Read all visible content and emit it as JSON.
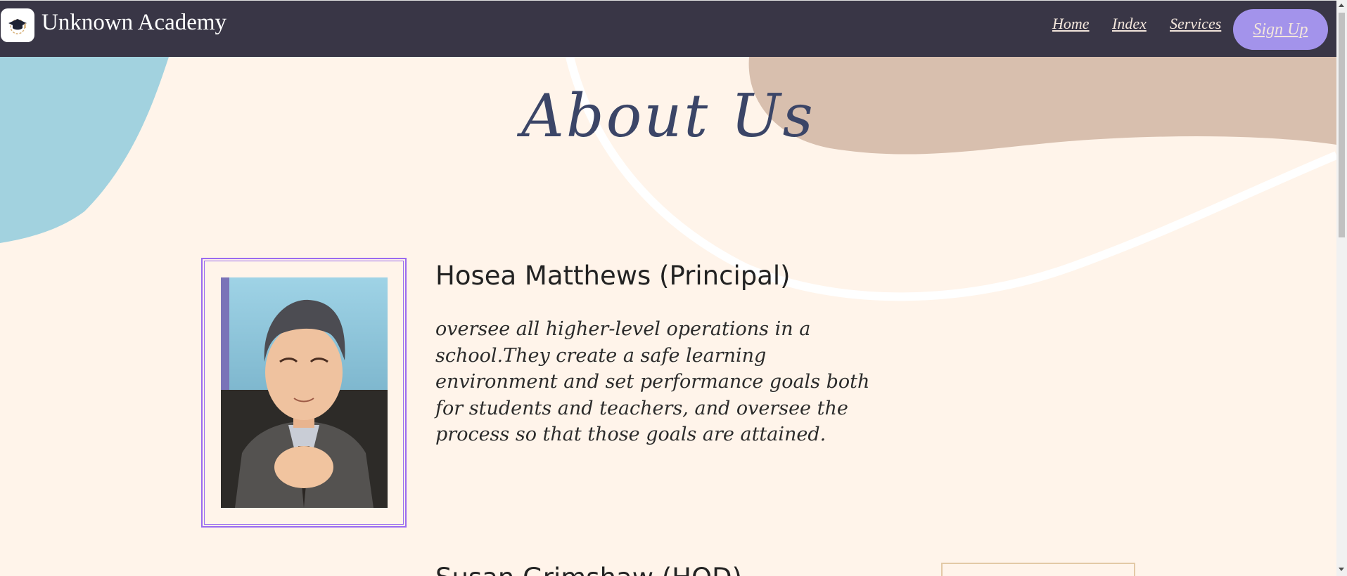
{
  "navbar": {
    "brand": "Unknown Academy",
    "links": {
      "home": "Home",
      "index": "Index",
      "services": "Services"
    },
    "signup_label": "Sign Up",
    "colors": {
      "background": "#393646",
      "signup": "#a393eb"
    }
  },
  "main": {
    "heading": "About Us",
    "staff": [
      {
        "name": "Hosea Matthews (Principal)",
        "description": "oversee all higher-level operations in a school.They create a safe learning environment and set performance goals both for students and teachers, and oversee the process so that those goals are attained."
      },
      {
        "name": "Susan Grimshaw (HOD)"
      }
    ]
  },
  "icons": {
    "logo": "graduation-cap-icon"
  }
}
